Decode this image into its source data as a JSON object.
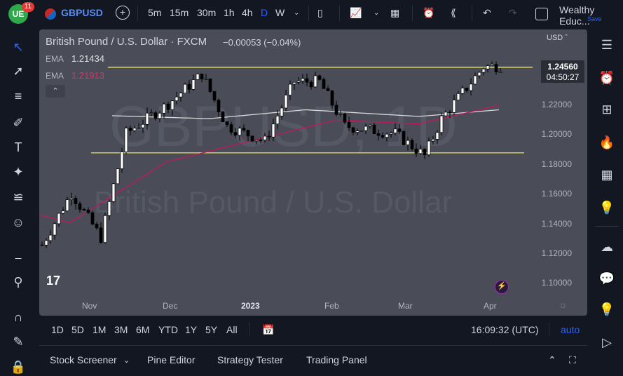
{
  "topbar": {
    "notif_count": "11",
    "symbol": "GBPUSD",
    "intervals": [
      "5m",
      "15m",
      "30m",
      "1h",
      "4h",
      "D",
      "W"
    ],
    "active_interval": "D",
    "layout_name": "Wealthy Educ...",
    "save_label": "Save"
  },
  "legend": {
    "title": "British Pound / U.S. Dollar · FXCM",
    "change": "−0.00053 (−0.04%)",
    "ema1_label": "EMA",
    "ema1_value": "1.21434",
    "ema2_label": "EMA",
    "ema2_value": "1.21913"
  },
  "watermark": {
    "symbol": "GBPUSD, 1D",
    "name": "British Pound / U.S. Dollar"
  },
  "price_axis": {
    "currency": "USD",
    "current_price": "1.24560",
    "countdown": "04:50:27",
    "ticks": [
      "1.22000",
      "1.20000",
      "1.18000",
      "1.16000",
      "1.14000",
      "1.12000",
      "1.10000"
    ]
  },
  "time_axis": {
    "ticks": [
      "Nov",
      "Dec",
      "2023",
      "Feb",
      "Mar",
      "Apr"
    ]
  },
  "bottom": {
    "ranges": [
      "1D",
      "5D",
      "1M",
      "3M",
      "6M",
      "YTD",
      "1Y",
      "5Y",
      "All"
    ],
    "clock": "16:09:32 (UTC)",
    "auto_label": "auto"
  },
  "footer": {
    "tabs": [
      "Stock Screener",
      "Pine Editor",
      "Strategy Tester",
      "Trading Panel"
    ]
  },
  "colors": {
    "accent": "#2962ff",
    "ema_white": "#d9d9d9",
    "ema_red": "#c2185b",
    "hline": "#e8e35a",
    "bg": "#4a4d58"
  },
  "chart_data": {
    "type": "candlestick",
    "ylim": [
      1.09,
      1.27
    ],
    "bars": 110,
    "close_anchors": [
      [
        0,
        1.125
      ],
      [
        7,
        1.16
      ],
      [
        14,
        1.13
      ],
      [
        20,
        1.2
      ],
      [
        30,
        1.22
      ],
      [
        38,
        1.24
      ],
      [
        44,
        1.205
      ],
      [
        53,
        1.195
      ],
      [
        60,
        1.235
      ],
      [
        66,
        1.235
      ],
      [
        72,
        1.205
      ],
      [
        84,
        1.2
      ],
      [
        91,
        1.185
      ],
      [
        95,
        1.21
      ],
      [
        105,
        1.245
      ],
      [
        109,
        1.2456
      ]
    ],
    "ema_white": [
      [
        17,
        1.212
      ],
      [
        40,
        1.21
      ],
      [
        63,
        1.216
      ],
      [
        90,
        1.2115
      ],
      [
        109,
        1.216
      ]
    ],
    "ema_red": [
      [
        0,
        1.145
      ],
      [
        7,
        1.14
      ],
      [
        30,
        1.181
      ],
      [
        50,
        1.195
      ],
      [
        70,
        1.209
      ],
      [
        90,
        1.2065
      ],
      [
        109,
        1.219
      ]
    ],
    "hlines": [
      {
        "price": 1.2446,
        "from": 16,
        "to": 117
      },
      {
        "price": 1.187,
        "from": 12,
        "to": 115
      }
    ]
  }
}
